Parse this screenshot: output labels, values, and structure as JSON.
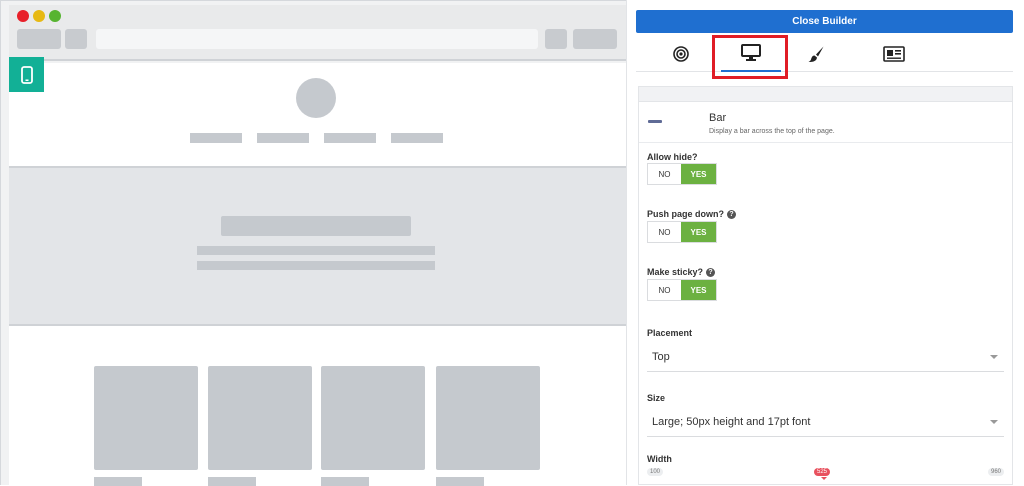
{
  "panel": {
    "close_label": "Close Builder",
    "tabs": [
      {
        "icon": "target-icon"
      },
      {
        "icon": "desktop-icon",
        "active": true
      },
      {
        "icon": "brush-icon"
      },
      {
        "icon": "newspaper-icon"
      }
    ],
    "bar": {
      "title": "Bar",
      "description": "Display a bar across the top of the page."
    },
    "fields": {
      "allow_hide": {
        "label": "Allow hide?",
        "no": "NO",
        "yes": "YES",
        "value": "YES"
      },
      "push_down": {
        "label": "Push page down?",
        "no": "NO",
        "yes": "YES",
        "value": "YES"
      },
      "sticky": {
        "label": "Make sticky?",
        "no": "NO",
        "yes": "YES",
        "value": "YES"
      },
      "placement": {
        "label": "Placement",
        "value": "Top"
      },
      "size": {
        "label": "Size",
        "value": "Large; 50px height and 17pt font"
      },
      "width": {
        "label": "Width",
        "min": "100",
        "max": "960",
        "value": "525"
      }
    }
  },
  "colors": {
    "accent": "#1f6fd0",
    "toggle_on": "#6cb141",
    "device_button": "#12b096",
    "highlight": "#e01d26"
  }
}
